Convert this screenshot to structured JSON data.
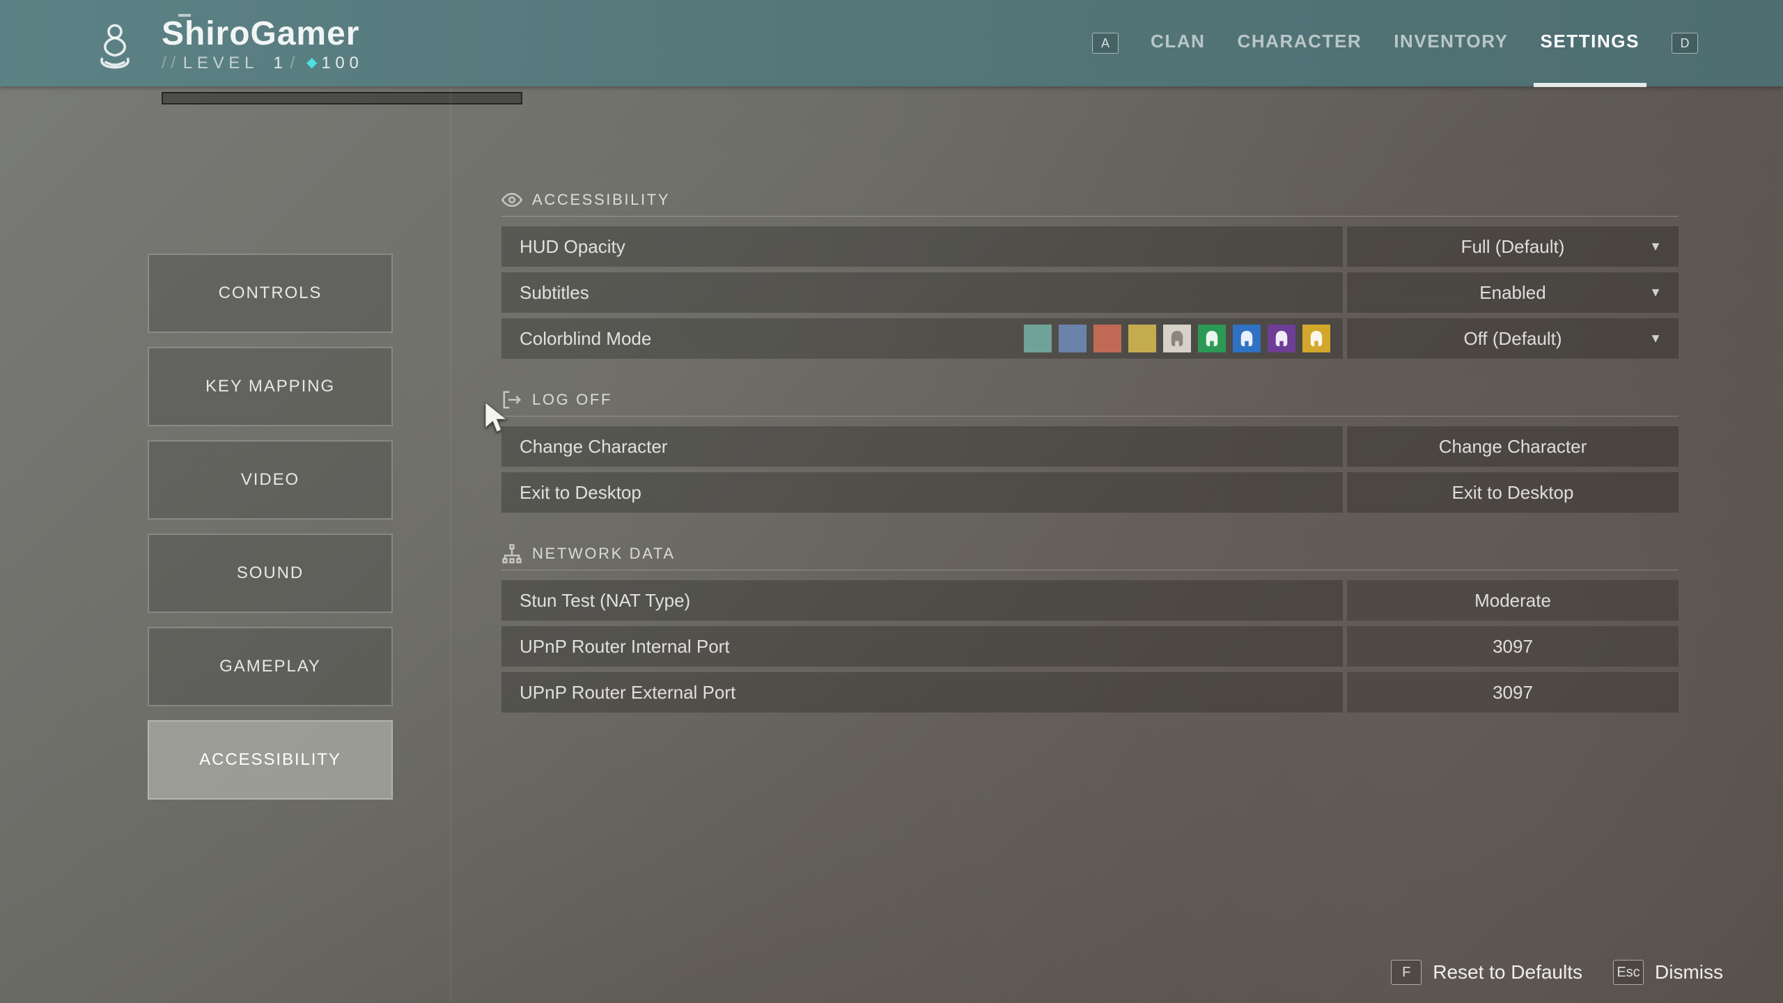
{
  "header": {
    "player_name": "ShiroGamer",
    "level_prefix": "LEVEL",
    "level": "1",
    "light": "100",
    "nav": {
      "key_left": "A",
      "key_right": "D",
      "items": [
        "CLAN",
        "CHARACTER",
        "INVENTORY",
        "SETTINGS"
      ],
      "active": "SETTINGS"
    }
  },
  "sidebar": {
    "items": [
      "CONTROLS",
      "KEY MAPPING",
      "VIDEO",
      "SOUND",
      "GAMEPLAY",
      "ACCESSIBILITY"
    ],
    "active": "ACCESSIBILITY"
  },
  "sections": {
    "accessibility": {
      "title": "ACCESSIBILITY",
      "hud_opacity": {
        "label": "HUD Opacity",
        "value": "Full (Default)"
      },
      "subtitles": {
        "label": "Subtitles",
        "value": "Enabled"
      },
      "colorblind": {
        "label": "Colorblind Mode",
        "value": "Off (Default)"
      },
      "cb_colors": {
        "plain": [
          "#6fa398",
          "#6b83a8",
          "#c06a56",
          "#c4ab4e"
        ],
        "helmet": [
          "#d7d2c8",
          "#2c9a55",
          "#2f72c4",
          "#6e3d96",
          "#d2a72b"
        ]
      }
    },
    "logoff": {
      "title": "LOG OFF",
      "change_char": {
        "label": "Change Character",
        "button": "Change Character"
      },
      "exit": {
        "label": "Exit to Desktop",
        "button": "Exit to Desktop"
      }
    },
    "network": {
      "title": "NETWORK DATA",
      "stun": {
        "label": "Stun Test (NAT Type)",
        "value": "Moderate"
      },
      "upnp_in": {
        "label": "UPnP Router Internal Port",
        "value": "3097"
      },
      "upnp_out": {
        "label": "UPnP Router External Port",
        "value": "3097"
      }
    }
  },
  "footer": {
    "reset_key": "F",
    "reset_label": "Reset to Defaults",
    "dismiss_key": "Esc",
    "dismiss_label": "Dismiss"
  }
}
